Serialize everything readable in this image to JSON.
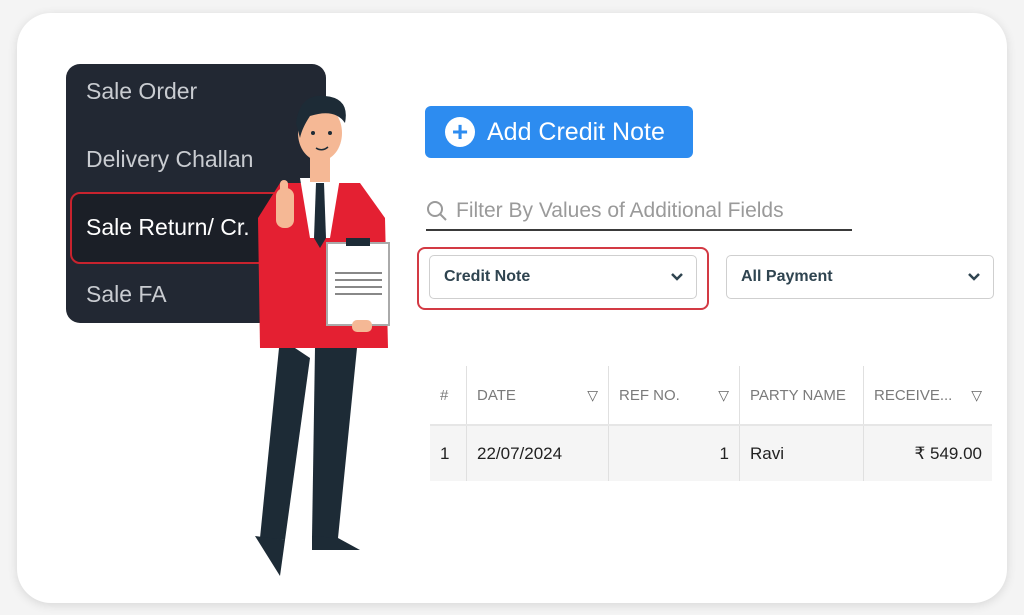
{
  "menu": {
    "items": [
      {
        "label": "Sale Order",
        "active": false
      },
      {
        "label": "Delivery Challan",
        "active": false
      },
      {
        "label": "Sale Return/ Cr.",
        "active": true
      },
      {
        "label": "Sale FA",
        "active": false
      }
    ]
  },
  "toolbar": {
    "add_button_label": "Add Credit Note",
    "add_icon": "plus-circle-icon"
  },
  "search": {
    "icon": "search-icon",
    "placeholder": "Filter By Values of Additional Fields"
  },
  "filters": {
    "type_select": {
      "value": "Credit Note"
    },
    "payment_select": {
      "value": "All Payment"
    }
  },
  "table": {
    "columns": [
      {
        "label": "#",
        "filter": false
      },
      {
        "label": "DATE",
        "filter": true
      },
      {
        "label": "REF NO.",
        "filter": true
      },
      {
        "label": "PARTY NAME",
        "filter": false
      },
      {
        "label": "RECEIVE...",
        "filter": true
      }
    ],
    "rows": [
      {
        "index": "1",
        "date": "22/07/2024",
        "ref_no": "1",
        "party_name": "Ravi",
        "received": "₹ 549.00"
      }
    ]
  },
  "colors": {
    "accent": "#2d8cf0",
    "highlight": "#d33a44",
    "menu_bg": "#222833"
  }
}
